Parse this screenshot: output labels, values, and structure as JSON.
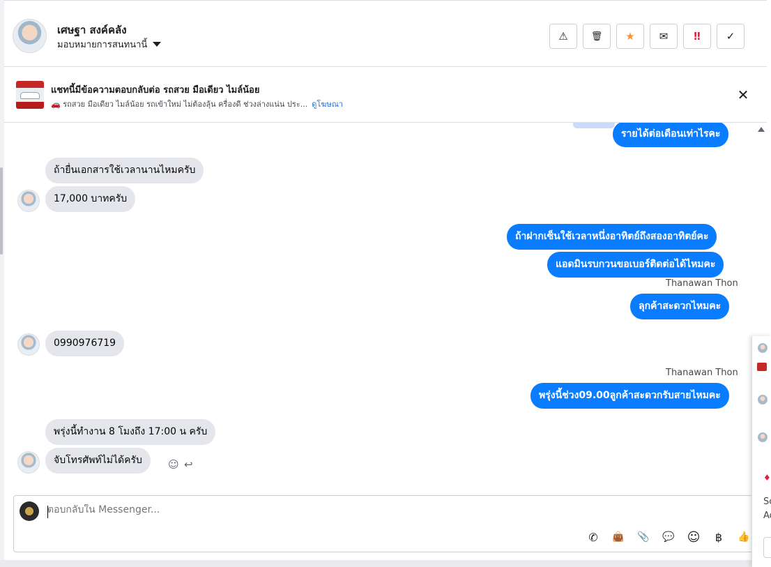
{
  "header": {
    "name": "เศษฐา สงค์คลัง",
    "assign_label": "มอบหมายการสนทนานี้",
    "actions": [
      {
        "icon": "warning-icon",
        "glyph": "⚠",
        "color": "#1c1e21"
      },
      {
        "icon": "trash-icon",
        "glyph": "🗑",
        "color": "#1c1e21"
      },
      {
        "icon": "star-icon",
        "glyph": "★",
        "color": "#f7923b"
      },
      {
        "icon": "envelope-icon",
        "glyph": "✉",
        "color": "#1c1e21"
      },
      {
        "icon": "exclamation-icon",
        "glyph": "‼",
        "color": "#e41e3f"
      },
      {
        "icon": "check-icon",
        "glyph": "✓",
        "color": "#1c1e21"
      }
    ]
  },
  "ad": {
    "title": "แชทนี้มีข้อความตอบกลับต่อ รถสวย มือเดียว ไมล์น้อย",
    "subtitle": "🚗 รถสวย มือเดียว ไมล์น้อย รถเข้าใหม่ ไม่ต้องลุ้น ครื่องดี ช่วงล่างแน่น ประ...",
    "link": "ดูโฆษณา",
    "close_glyph": "✕"
  },
  "messages": [
    {
      "dir": "out",
      "text": "รายได้ต่อเดือนเท่าไรคะ"
    },
    {
      "dir": "in",
      "text": "ถ้ายื่นเอกสารใช้เวลานานไหมครับ"
    },
    {
      "dir": "in",
      "text": "17,000 บาทครับ"
    },
    {
      "dir": "out",
      "text": "ถ้าฝากเซ็นใช้เวลาหนึ่งอาทิตย์ถึงสองอาทิตย์คะ"
    },
    {
      "dir": "out",
      "text": "แอดมินรบกวนขอเบอร์ติดต่อได้ไหมคะ"
    },
    {
      "dir": "out",
      "text": "ลุกค้าสะดวกไหมคะ",
      "sender": "Thanawan Thon"
    },
    {
      "dir": "in",
      "text": "0990976719"
    },
    {
      "dir": "out",
      "text": "พรุ่งนี้ช่วง09.00ลูกค้าสะดวกรับสายไหมคะ",
      "sender": "Thanawan Thon"
    },
    {
      "dir": "in",
      "text": "พรุ่งนี้ทำงาน 8 โมงถึง 17:00 น ครับ"
    },
    {
      "dir": "in",
      "text": "จับโทรศัพท์ไม่ได้ครับ"
    }
  ],
  "composer": {
    "placeholder": "ตอบกลับใน Messenger...",
    "tools": [
      {
        "icon": "phone-add-icon",
        "glyph": "✆"
      },
      {
        "icon": "shopping-bag-icon",
        "glyph": "👜"
      },
      {
        "icon": "paperclip-icon",
        "glyph": "📎"
      },
      {
        "icon": "saved-reply-icon",
        "glyph": "💬"
      },
      {
        "icon": "emoji-icon",
        "glyph": "☺"
      },
      {
        "icon": "baht-icon",
        "glyph": "฿"
      },
      {
        "icon": "thumbs-up-icon",
        "glyph": "👍"
      }
    ]
  },
  "side_panel": {
    "text_1": "Sc",
    "text_2": "Ad"
  }
}
